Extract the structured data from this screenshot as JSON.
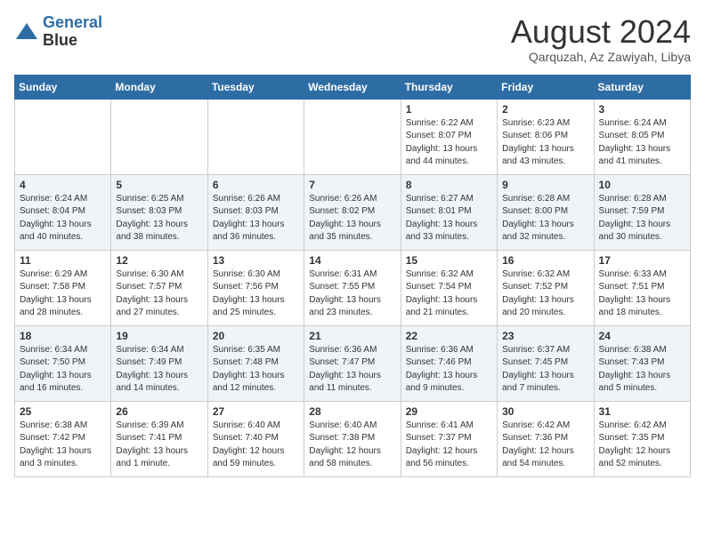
{
  "header": {
    "logo_line1": "General",
    "logo_line2": "Blue",
    "month": "August 2024",
    "location": "Qarquzah, Az Zawiyah, Libya"
  },
  "weekdays": [
    "Sunday",
    "Monday",
    "Tuesday",
    "Wednesday",
    "Thursday",
    "Friday",
    "Saturday"
  ],
  "weeks": [
    [
      {
        "day": "",
        "info": ""
      },
      {
        "day": "",
        "info": ""
      },
      {
        "day": "",
        "info": ""
      },
      {
        "day": "",
        "info": ""
      },
      {
        "day": "1",
        "info": "Sunrise: 6:22 AM\nSunset: 8:07 PM\nDaylight: 13 hours\nand 44 minutes."
      },
      {
        "day": "2",
        "info": "Sunrise: 6:23 AM\nSunset: 8:06 PM\nDaylight: 13 hours\nand 43 minutes."
      },
      {
        "day": "3",
        "info": "Sunrise: 6:24 AM\nSunset: 8:05 PM\nDaylight: 13 hours\nand 41 minutes."
      }
    ],
    [
      {
        "day": "4",
        "info": "Sunrise: 6:24 AM\nSunset: 8:04 PM\nDaylight: 13 hours\nand 40 minutes."
      },
      {
        "day": "5",
        "info": "Sunrise: 6:25 AM\nSunset: 8:03 PM\nDaylight: 13 hours\nand 38 minutes."
      },
      {
        "day": "6",
        "info": "Sunrise: 6:26 AM\nSunset: 8:03 PM\nDaylight: 13 hours\nand 36 minutes."
      },
      {
        "day": "7",
        "info": "Sunrise: 6:26 AM\nSunset: 8:02 PM\nDaylight: 13 hours\nand 35 minutes."
      },
      {
        "day": "8",
        "info": "Sunrise: 6:27 AM\nSunset: 8:01 PM\nDaylight: 13 hours\nand 33 minutes."
      },
      {
        "day": "9",
        "info": "Sunrise: 6:28 AM\nSunset: 8:00 PM\nDaylight: 13 hours\nand 32 minutes."
      },
      {
        "day": "10",
        "info": "Sunrise: 6:28 AM\nSunset: 7:59 PM\nDaylight: 13 hours\nand 30 minutes."
      }
    ],
    [
      {
        "day": "11",
        "info": "Sunrise: 6:29 AM\nSunset: 7:58 PM\nDaylight: 13 hours\nand 28 minutes."
      },
      {
        "day": "12",
        "info": "Sunrise: 6:30 AM\nSunset: 7:57 PM\nDaylight: 13 hours\nand 27 minutes."
      },
      {
        "day": "13",
        "info": "Sunrise: 6:30 AM\nSunset: 7:56 PM\nDaylight: 13 hours\nand 25 minutes."
      },
      {
        "day": "14",
        "info": "Sunrise: 6:31 AM\nSunset: 7:55 PM\nDaylight: 13 hours\nand 23 minutes."
      },
      {
        "day": "15",
        "info": "Sunrise: 6:32 AM\nSunset: 7:54 PM\nDaylight: 13 hours\nand 21 minutes."
      },
      {
        "day": "16",
        "info": "Sunrise: 6:32 AM\nSunset: 7:52 PM\nDaylight: 13 hours\nand 20 minutes."
      },
      {
        "day": "17",
        "info": "Sunrise: 6:33 AM\nSunset: 7:51 PM\nDaylight: 13 hours\nand 18 minutes."
      }
    ],
    [
      {
        "day": "18",
        "info": "Sunrise: 6:34 AM\nSunset: 7:50 PM\nDaylight: 13 hours\nand 16 minutes."
      },
      {
        "day": "19",
        "info": "Sunrise: 6:34 AM\nSunset: 7:49 PM\nDaylight: 13 hours\nand 14 minutes."
      },
      {
        "day": "20",
        "info": "Sunrise: 6:35 AM\nSunset: 7:48 PM\nDaylight: 13 hours\nand 12 minutes."
      },
      {
        "day": "21",
        "info": "Sunrise: 6:36 AM\nSunset: 7:47 PM\nDaylight: 13 hours\nand 11 minutes."
      },
      {
        "day": "22",
        "info": "Sunrise: 6:36 AM\nSunset: 7:46 PM\nDaylight: 13 hours\nand 9 minutes."
      },
      {
        "day": "23",
        "info": "Sunrise: 6:37 AM\nSunset: 7:45 PM\nDaylight: 13 hours\nand 7 minutes."
      },
      {
        "day": "24",
        "info": "Sunrise: 6:38 AM\nSunset: 7:43 PM\nDaylight: 13 hours\nand 5 minutes."
      }
    ],
    [
      {
        "day": "25",
        "info": "Sunrise: 6:38 AM\nSunset: 7:42 PM\nDaylight: 13 hours\nand 3 minutes."
      },
      {
        "day": "26",
        "info": "Sunrise: 6:39 AM\nSunset: 7:41 PM\nDaylight: 13 hours\nand 1 minute."
      },
      {
        "day": "27",
        "info": "Sunrise: 6:40 AM\nSunset: 7:40 PM\nDaylight: 12 hours\nand 59 minutes."
      },
      {
        "day": "28",
        "info": "Sunrise: 6:40 AM\nSunset: 7:38 PM\nDaylight: 12 hours\nand 58 minutes."
      },
      {
        "day": "29",
        "info": "Sunrise: 6:41 AM\nSunset: 7:37 PM\nDaylight: 12 hours\nand 56 minutes."
      },
      {
        "day": "30",
        "info": "Sunrise: 6:42 AM\nSunset: 7:36 PM\nDaylight: 12 hours\nand 54 minutes."
      },
      {
        "day": "31",
        "info": "Sunrise: 6:42 AM\nSunset: 7:35 PM\nDaylight: 12 hours\nand 52 minutes."
      }
    ]
  ]
}
